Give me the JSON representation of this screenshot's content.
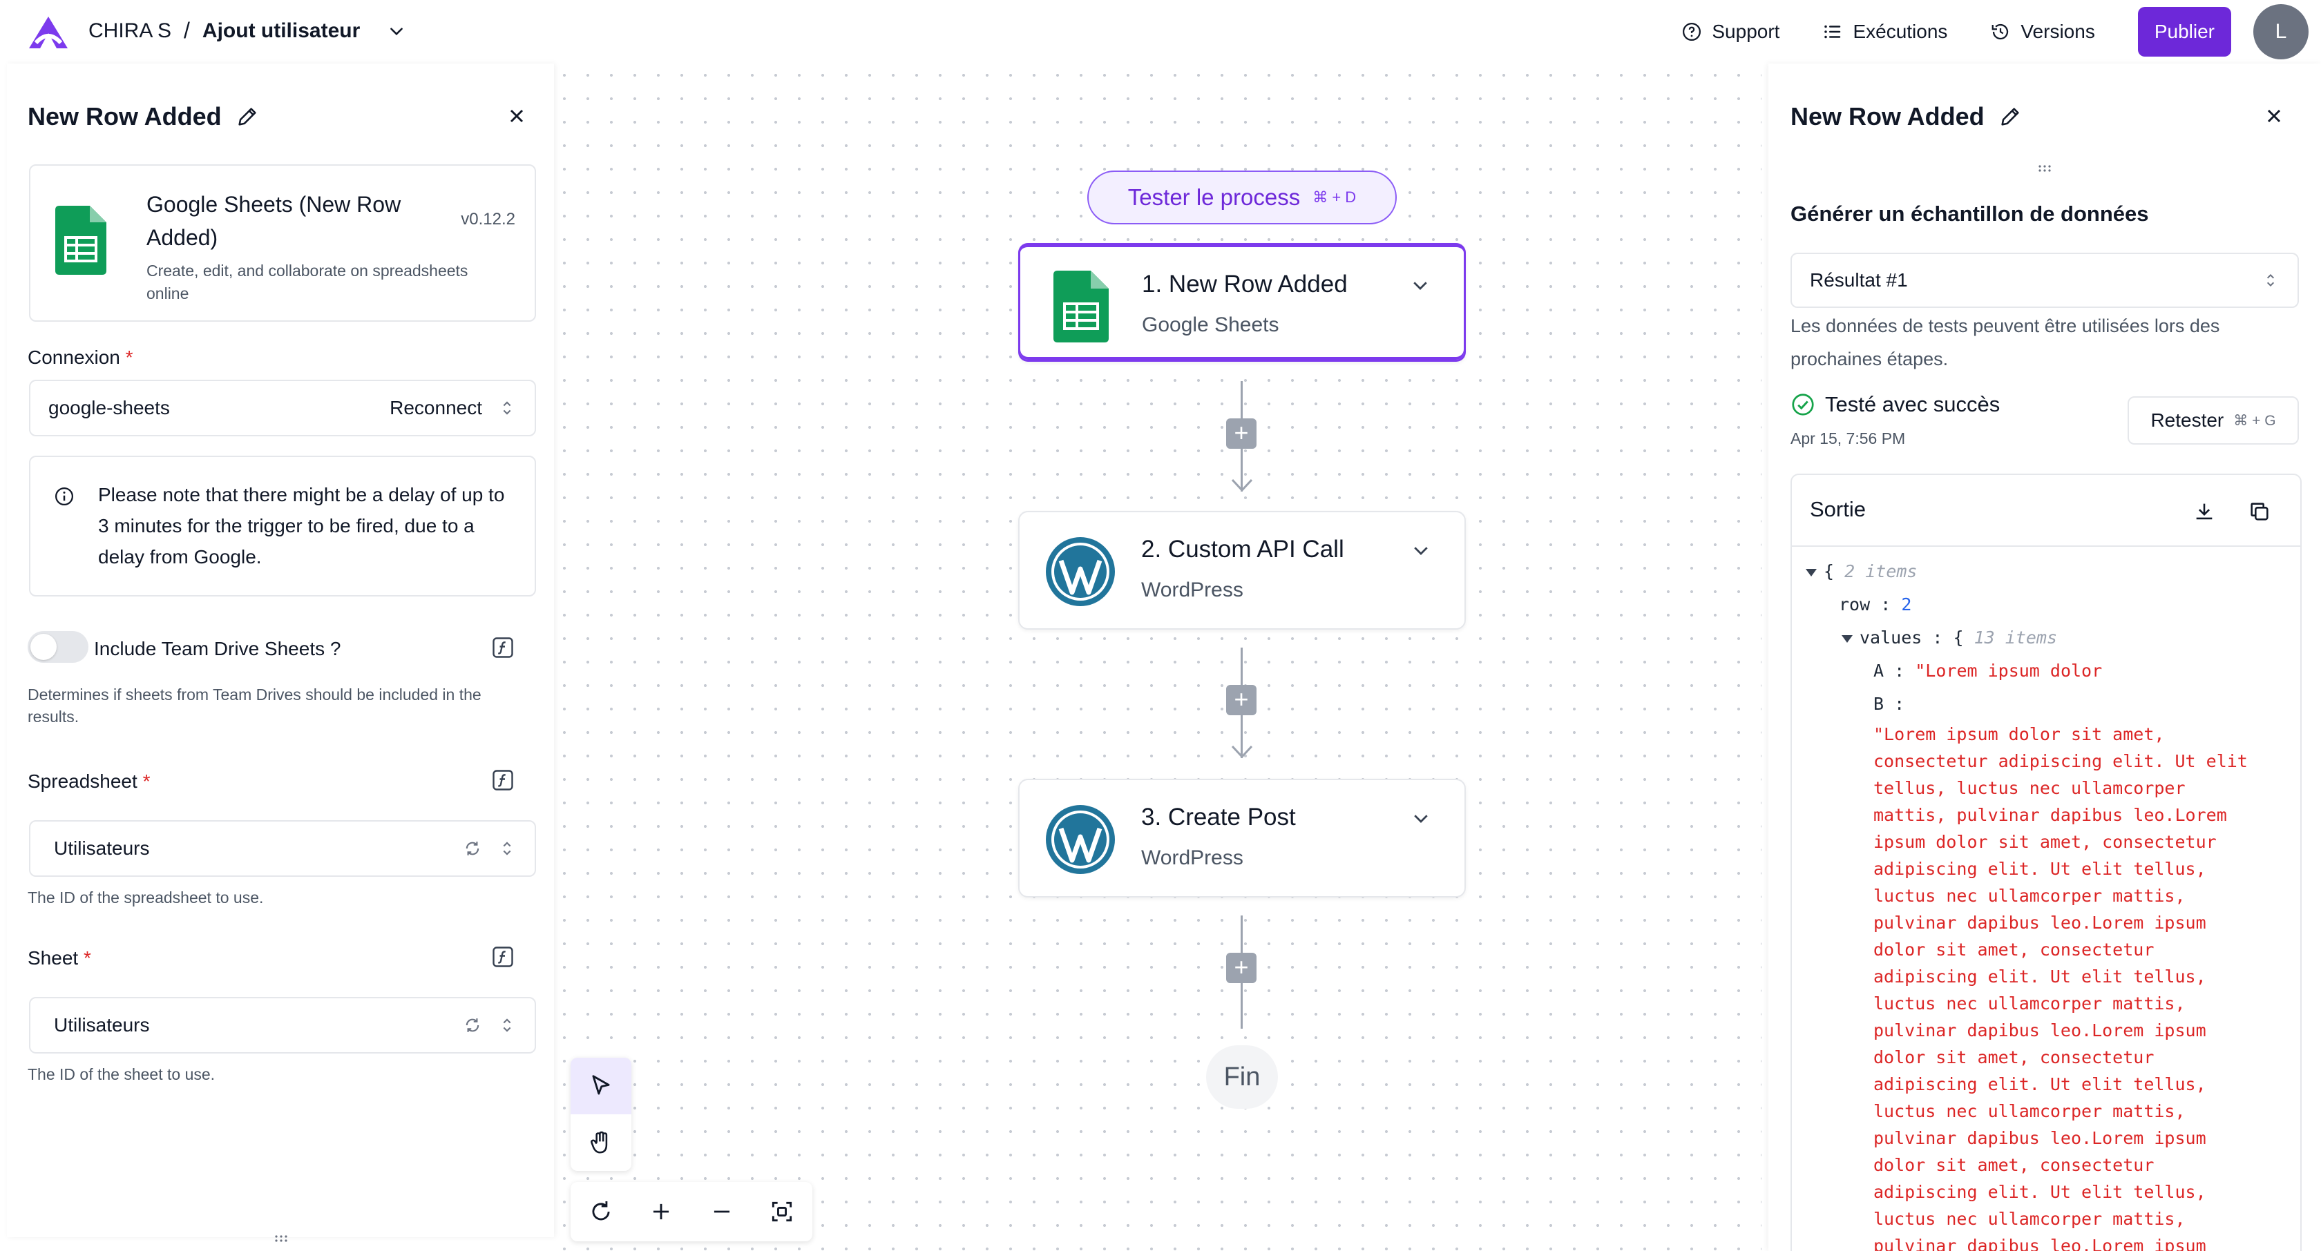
{
  "header": {
    "workspace": "CHIRA S",
    "separator": "/",
    "project": "Ajout utilisateur",
    "links": {
      "support": "Support",
      "executions": "Exécutions",
      "versions": "Versions"
    },
    "publish_label": "Publier",
    "avatar_initial": "L"
  },
  "canvas": {
    "test_button": {
      "label": "Tester le process",
      "shortcut": "⌘ + D"
    },
    "steps": [
      {
        "title": "1. New Row Added",
        "subtitle": "Google Sheets",
        "icon": "google-sheets-icon",
        "active": true
      },
      {
        "title": "2. Custom API Call",
        "subtitle": "WordPress",
        "icon": "wordpress-icon",
        "active": false
      },
      {
        "title": "3. Create Post",
        "subtitle": "WordPress",
        "icon": "wordpress-icon",
        "active": false
      }
    ],
    "end_label": "Fin"
  },
  "left_panel": {
    "title": "New Row Added",
    "piece": {
      "name": "Google Sheets (New Row Added)",
      "version": "v0.12.2",
      "description": "Create, edit, and collaborate on spreadsheets online"
    },
    "connection": {
      "label": "Connexion",
      "required_mark": "*",
      "value": "google-sheets",
      "action": "Reconnect"
    },
    "notice": "Please note that there might be a delay of up to 3 minutes for the trigger to be fired, due to a delay from Google.",
    "team_drive": {
      "label": "Include Team Drive Sheets ?",
      "enabled": false,
      "help": "Determines if sheets from Team Drives should be included in the results."
    },
    "spreadsheet": {
      "label": "Spreadsheet",
      "required_mark": "*",
      "value": "Utilisateurs",
      "help": "The ID of the spreadsheet to use."
    },
    "sheet": {
      "label": "Sheet",
      "required_mark": "*",
      "value": "Utilisateurs",
      "help": "The ID of the sheet to use."
    }
  },
  "right_panel": {
    "title": "New Row Added",
    "section_title": "Générer un échantillon de données",
    "result_select": "Résultat #1",
    "help": "Les données de tests peuvent être utilisées lors des prochaines étapes.",
    "status": "Testé avec succès",
    "tested_at": "Apr 15, 7:56 PM",
    "retest": {
      "label": "Retester",
      "shortcut": "⌘ + G"
    },
    "output": {
      "title": "Sortie",
      "root_brace": "{",
      "root_count": "2 items",
      "row_key": "row",
      "row_value": "2",
      "values_key": "values",
      "values_brace": "{",
      "values_count": "13 items",
      "a_key": "A",
      "a_value": "\"Lorem ipsum dolor",
      "b_key": "B",
      "b_value": "\"Lorem ipsum dolor sit amet, consectetur adipiscing elit. Ut elit tellus, luctus nec ullamcorper mattis, pulvinar dapibus leo.Lorem ipsum dolor sit amet, consectetur adipiscing elit. Ut elit tellus, luctus nec ullamcorper mattis, pulvinar dapibus leo.Lorem ipsum dolor sit amet, consectetur adipiscing elit. Ut elit tellus, luctus nec ullamcorper mattis, pulvinar dapibus leo.Lorem ipsum dolor sit amet, consectetur adipiscing elit. Ut elit tellus, luctus nec ullamcorper mattis, pulvinar dapibus leo.Lorem ipsum dolor sit amet, consectetur adipiscing elit. Ut elit tellus, luctus nec ullamcorper mattis, pulvinar dapibus leo.Lorem ipsum"
    }
  },
  "colors": {
    "brand": "#6d28d9",
    "active_border": "#7c3aed",
    "json_string": "#dc2626",
    "json_number": "#2563eb",
    "success": "#16a34a",
    "sheets_green": "#0f9d58",
    "wordpress_blue": "#21759b"
  }
}
